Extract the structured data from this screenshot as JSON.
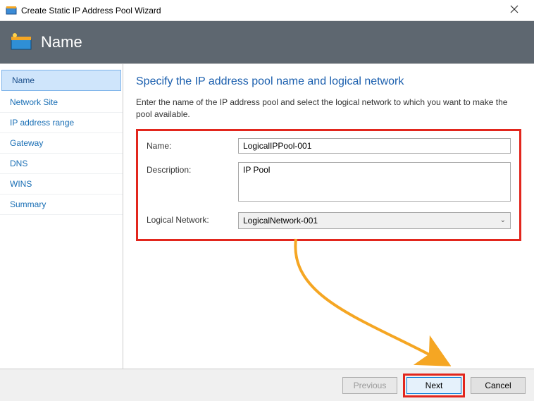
{
  "window": {
    "title": "Create Static IP Address Pool Wizard"
  },
  "banner": {
    "title": "Name"
  },
  "sidebar": {
    "items": [
      {
        "label": "Name"
      },
      {
        "label": "Network Site"
      },
      {
        "label": "IP address range"
      },
      {
        "label": "Gateway"
      },
      {
        "label": "DNS"
      },
      {
        "label": "WINS"
      },
      {
        "label": "Summary"
      }
    ]
  },
  "content": {
    "heading": "Specify the IP address pool name and logical network",
    "intro": "Enter the name of the IP address pool and select the logical network to which you want to make the pool available.",
    "fields": {
      "name_label": "Name:",
      "name_value": "LogicalIPPool-001",
      "desc_label": "Description:",
      "desc_value": "IP Pool",
      "net_label": "Logical Network:",
      "net_value": "LogicalNetwork-001"
    }
  },
  "footer": {
    "previous": "Previous",
    "next": "Next",
    "cancel": "Cancel"
  }
}
